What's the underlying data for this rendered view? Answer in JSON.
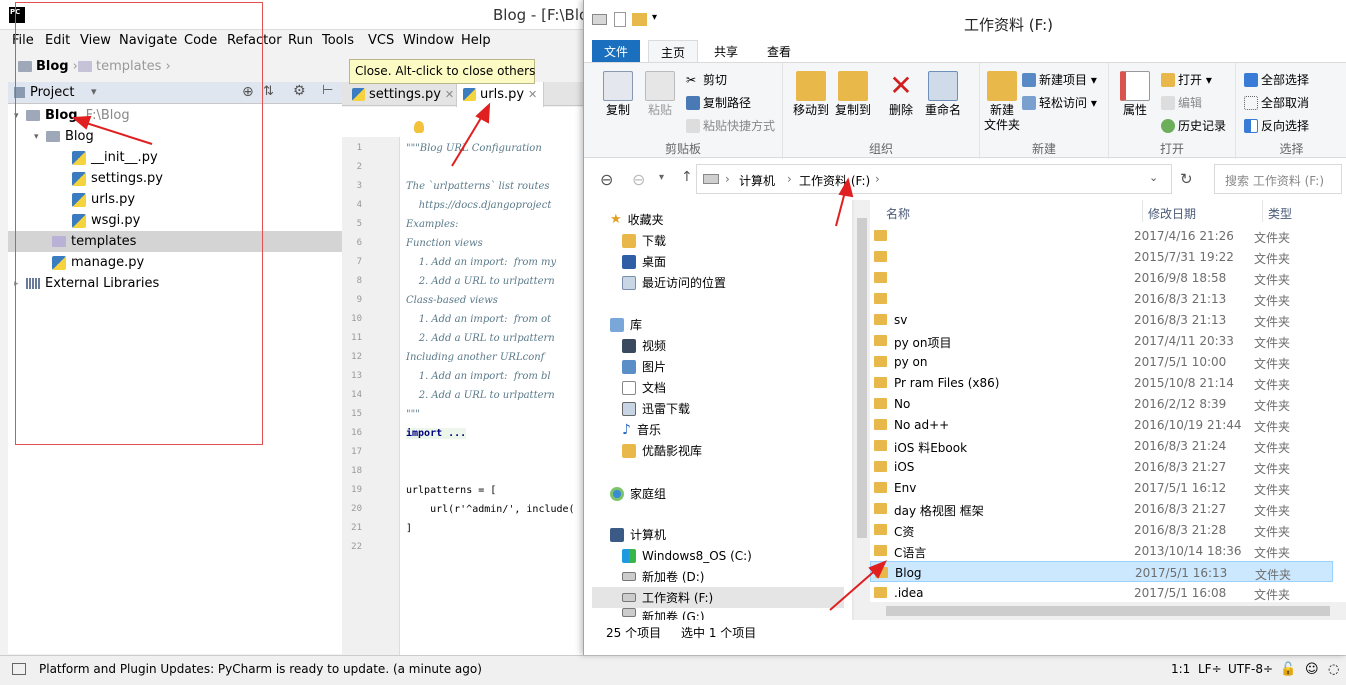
{
  "pycharm": {
    "window_title": "Blog - [F:\\Blo",
    "menu": [
      "File",
      "Edit",
      "View",
      "Navigate",
      "Code",
      "Refactor",
      "Run",
      "Tools",
      "VCS",
      "Window",
      "Help"
    ],
    "breadcrumb": [
      "Blog",
      "templates"
    ],
    "project_panel_title": "Project",
    "tree": [
      {
        "label": "Blog",
        "path": "F:\\Blog"
      },
      {
        "label": "Blog"
      },
      {
        "label": "__init__.py"
      },
      {
        "label": "settings.py"
      },
      {
        "label": "urls.py"
      },
      {
        "label": "wsgi.py"
      },
      {
        "label": "templates"
      },
      {
        "label": "manage.py"
      },
      {
        "label": "External Libraries"
      }
    ],
    "tabs": [
      "settings.py",
      "urls.py"
    ],
    "tooltip": "Close. Alt-click to close others",
    "line_numbers": [
      "1",
      "2",
      "3",
      "4",
      "5",
      "6",
      "7",
      "8",
      "9",
      "10",
      "11",
      "12",
      "13",
      "14",
      "15",
      "16",
      "17",
      "18",
      "19",
      "20",
      "21",
      "22"
    ],
    "code_lines": [
      "\"\"\"Blog URL Configuration",
      "",
      "The `urlpatterns` list routes",
      "    https://docs.djangoproject",
      "Examples:",
      "Function views",
      "    1. Add an import:  from my",
      "    2. Add a URL to urlpattern",
      "Class-based views",
      "    1. Add an import:  from ot",
      "    2. Add a URL to urlpattern",
      "Including another URLconf",
      "    1. Add an import:  from bl",
      "    2. Add a URL to urlpattern",
      "\"\"\"",
      "import ...",
      "",
      "",
      "urlpatterns = [",
      "    url(r'^admin/', include(",
      "]",
      ""
    ],
    "status": {
      "message": "Platform and Plugin Updates: PyCharm is ready to update. (a minute ago)",
      "position": "1:1",
      "line_sep": "LF÷",
      "encoding": "UTF-8÷"
    }
  },
  "explorer": {
    "window_title": "工作资料 (F:)",
    "ribbon_tabs": [
      "文件",
      "主页",
      "共享",
      "查看"
    ],
    "clipboard": {
      "copy": "复制",
      "paste": "粘贴",
      "cut": "剪切",
      "copy_path": "复制路径",
      "paste_shortcut": "粘贴快捷方式",
      "label": "剪贴板"
    },
    "organize": {
      "move_to": "移动到",
      "copy_to": "复制到",
      "delete": "删除",
      "rename": "重命名",
      "label": "组织"
    },
    "new": {
      "new_folder": "新建\n文件夹",
      "new_item": "新建项目 ▾",
      "easy_access": "轻松访问 ▾",
      "label": "新建"
    },
    "open": {
      "properties": "属性",
      "open": "打开 ▾",
      "edit": "编辑",
      "history": "历史记录",
      "label": "打开"
    },
    "select": {
      "select_all": "全部选择",
      "select_none": "全部取消",
      "invert": "反向选择",
      "label": "选择"
    },
    "address": [
      "计算机",
      "工作资料 (F:)"
    ],
    "search_placeholder": "搜索 工作资料 (F:)",
    "nav": {
      "favorites": "收藏夹",
      "downloads": "下载",
      "desktop": "桌面",
      "recent": "最近访问的位置",
      "libraries": "库",
      "videos": "视频",
      "pictures": "图片",
      "documents": "文档",
      "xunlei": "迅雷下载",
      "music": "音乐",
      "youku": "优酷影视库",
      "homegroup": "家庭组",
      "computer": "计算机",
      "drive_c": "Windows8_OS (C:)",
      "drive_d": "新加卷 (D:)",
      "drive_f": "工作资料 (F:)",
      "drive_g": "新加卷 (G:)"
    },
    "columns": [
      "名称",
      "修改日期",
      "类型"
    ],
    "files": [
      {
        "name": "",
        "date": "2017/4/16 21:26",
        "type": "文件夹"
      },
      {
        "name": "",
        "date": "2015/7/31 19:22",
        "type": "文件夹"
      },
      {
        "name": "",
        "date": "2016/9/8 18:58",
        "type": "文件夹"
      },
      {
        "name": "",
        "date": "2016/8/3 21:13",
        "type": "文件夹"
      },
      {
        "name": "sv",
        "date": "2016/8/3 21:13",
        "type": "文件夹"
      },
      {
        "name": "py    on项目",
        "date": "2017/4/11 20:33",
        "type": "文件夹"
      },
      {
        "name": "py    on",
        "date": "2017/5/1 10:00",
        "type": "文件夹"
      },
      {
        "name": "Pr    ram Files (x86)",
        "date": "2015/10/8 21:14",
        "type": "文件夹"
      },
      {
        "name": "No",
        "date": "2016/2/12 8:39",
        "type": "文件夹"
      },
      {
        "name": "No     ad++",
        "date": "2016/10/19 21:44",
        "type": "文件夹"
      },
      {
        "name": "iOS   料Ebook",
        "date": "2016/8/3 21:24",
        "type": "文件夹"
      },
      {
        "name": "iOS",
        "date": "2016/8/3 21:27",
        "type": "文件夹"
      },
      {
        "name": "Env",
        "date": "2017/5/1 16:12",
        "type": "文件夹"
      },
      {
        "name": "day    格视图 框架",
        "date": "2016/8/3 21:27",
        "type": "文件夹"
      },
      {
        "name": "C资",
        "date": "2016/8/3 21:28",
        "type": "文件夹"
      },
      {
        "name": "C语言",
        "date": "2013/10/14 18:36",
        "type": "文件夹"
      },
      {
        "name": "Blog",
        "date": "2017/5/1 16:13",
        "type": "文件夹"
      },
      {
        "name": ".idea",
        "date": "2017/5/1 16:08",
        "type": "文件夹"
      }
    ],
    "status": {
      "count": "25 个项目",
      "selected": "选中 1 个项目"
    }
  }
}
